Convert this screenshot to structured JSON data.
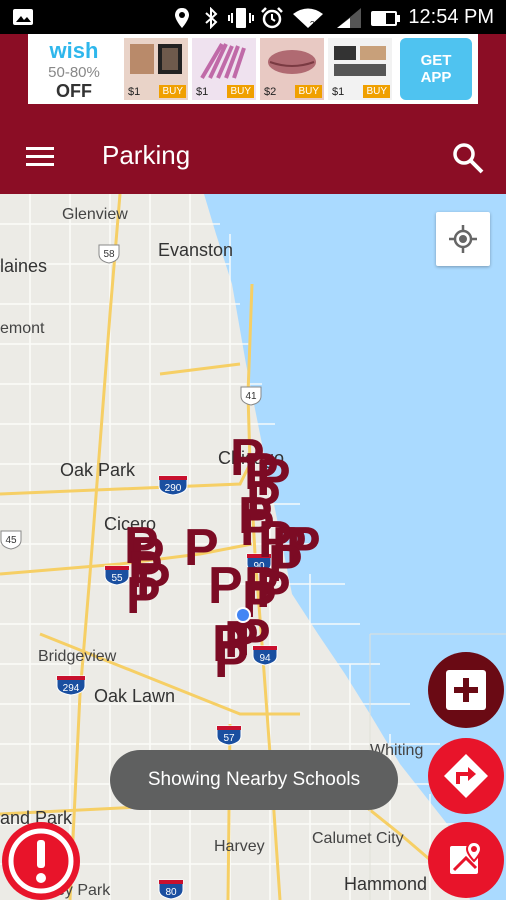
{
  "status_bar": {
    "time": "12:54 PM"
  },
  "ad": {
    "brand": "wish",
    "discount": "50-80%",
    "off": "OFF",
    "products": [
      {
        "price": "$1",
        "buy": "BUY"
      },
      {
        "price": "$1",
        "buy": "BUY"
      },
      {
        "price": "$2",
        "buy": "BUY"
      },
      {
        "price": "$1",
        "buy": "BUY"
      }
    ],
    "cta_line1": "GET",
    "cta_line2": "APP"
  },
  "app_bar": {
    "title": "Parking",
    "menu_icon": "menu-icon",
    "search_icon": "search-icon"
  },
  "map": {
    "labels": [
      {
        "text": "Glenview"
      },
      {
        "text": "Evanston"
      },
      {
        "text": "laines"
      },
      {
        "text": "emont"
      },
      {
        "text": "Oak Park"
      },
      {
        "text": "Cicero"
      },
      {
        "text": "Chicago"
      },
      {
        "text": "Bridgeview"
      },
      {
        "text": "Oak Lawn"
      },
      {
        "text": "Whiting"
      },
      {
        "text": "Harvey"
      },
      {
        "text": "Calumet City"
      },
      {
        "text": "Hammond"
      },
      {
        "text": "and Park"
      },
      {
        "text": "inley Park"
      }
    ],
    "shields": [
      {
        "text": "58"
      },
      {
        "text": "41"
      },
      {
        "text": "290"
      },
      {
        "text": "45"
      },
      {
        "text": "55"
      },
      {
        "text": "90"
      },
      {
        "text": "94"
      },
      {
        "text": "294"
      },
      {
        "text": "57"
      },
      {
        "text": "80"
      }
    ],
    "parking_marker_letter": "P",
    "marker_count": 24
  },
  "toast": {
    "message": "Showing Nearby Schools"
  },
  "colors": {
    "brand": "#8b0d25",
    "marker": "#7c0b24",
    "fab_red": "#e8142a",
    "fab_dark": "#6a0a14",
    "water": "#aadaff",
    "land": "#ecebe6"
  }
}
